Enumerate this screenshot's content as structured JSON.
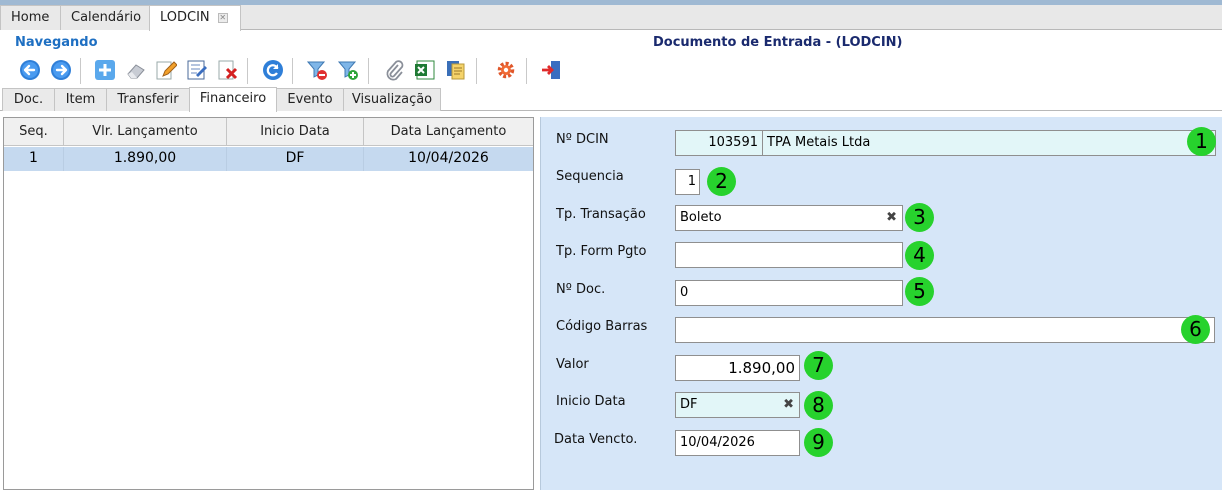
{
  "app_tabs": [
    {
      "label": "Home"
    },
    {
      "label": "Calendário"
    },
    {
      "label": "LODCIN"
    }
  ],
  "status": "Navegando",
  "document_title": "Documento de Entrada - (LODCIN)",
  "toolbar_icons": [
    "back-arrow-icon",
    "forward-arrow-icon",
    "add-icon",
    "eraser-icon",
    "pencil-edit-icon",
    "notebook-edit-icon",
    "delete-icon",
    "refresh-icon",
    "filter-remove-icon",
    "filter-add-icon",
    "paperclip-icon",
    "excel-icon",
    "copy-documents-icon",
    "gear-icon",
    "exit-icon"
  ],
  "sub_tabs": [
    "Doc.",
    "Item",
    "Transferir",
    "Financeiro",
    "Evento",
    "Visualização"
  ],
  "grid": {
    "columns": [
      "Seq.",
      "Vlr. Lançamento",
      "Inicio Data",
      "Data Lançamento"
    ],
    "rows": [
      [
        "1",
        "1.890,00",
        "DF",
        "10/04/2026"
      ]
    ]
  },
  "form": {
    "dcin": {
      "label": "Nº DCIN",
      "code": "103591",
      "name": "TPA Metais Ltda",
      "badge": "1"
    },
    "sequencia": {
      "label": "Sequencia",
      "value": "1",
      "badge": "2"
    },
    "tp_transacao": {
      "label": "Tp. Transação",
      "value": "Boleto",
      "clear": "✖",
      "badge": "3"
    },
    "tp_form_pgto": {
      "label": "Tp. Form Pgto",
      "value": "",
      "badge": "4"
    },
    "n_doc": {
      "label": "Nº Doc.",
      "value": "0",
      "badge": "5"
    },
    "codigo_barras": {
      "label": "Código Barras",
      "value": "",
      "badge": "6"
    },
    "valor": {
      "label": "Valor",
      "value": "1.890,00",
      "badge": "7"
    },
    "inicio_data": {
      "label": "Inicio Data",
      "value": "DF",
      "clear": "✖",
      "badge": "8"
    },
    "data_vencto": {
      "label": "Data Vencto.",
      "value": "10/04/2026",
      "badge": "9"
    }
  },
  "colors": {
    "badge": "#27d22d",
    "form_bg": "#d6e6f8",
    "selected_row": "#c5d9ef",
    "status": "#1e6fc2",
    "title": "#1a2a6e"
  }
}
